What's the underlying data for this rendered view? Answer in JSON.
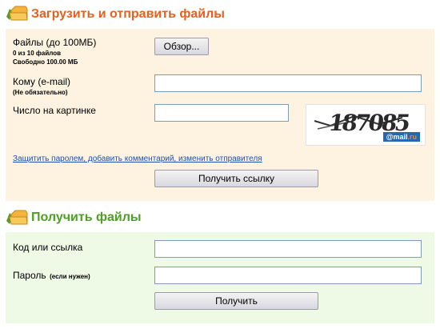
{
  "upload": {
    "title": "Загрузить и отправить файлы",
    "files_label": "Файлы (до 100МБ)",
    "files_count": "0 из 10 файлов",
    "files_free": "Свободно 100.00 МБ",
    "browse_button": "Обзор...",
    "to_label": "Кому (e-mail)",
    "to_hint": "(Не обязательно)",
    "to_value": "",
    "captcha_label": "Число на картинке",
    "captcha_value": "",
    "captcha_image_text": "187085",
    "captcha_brand": "@mail.ru",
    "options_link": "Защитить паролем, добавить комментарий, изменить отправителя",
    "submit_button": "Получить ссылку"
  },
  "download": {
    "title": "Получить файлы",
    "code_label": "Код или ссылка",
    "code_value": "",
    "password_label": "Пароль",
    "password_hint": "(если нужен)",
    "password_value": "",
    "submit_button": "Получить"
  },
  "colors": {
    "upload_title": "#e8601c",
    "download_title": "#4ea023",
    "upload_panel": "#fdf3e0",
    "download_panel": "#eef9e6",
    "link": "#1e4fae"
  },
  "icons": {
    "upload_section": "folder-icon",
    "download_section": "folder-icon"
  }
}
